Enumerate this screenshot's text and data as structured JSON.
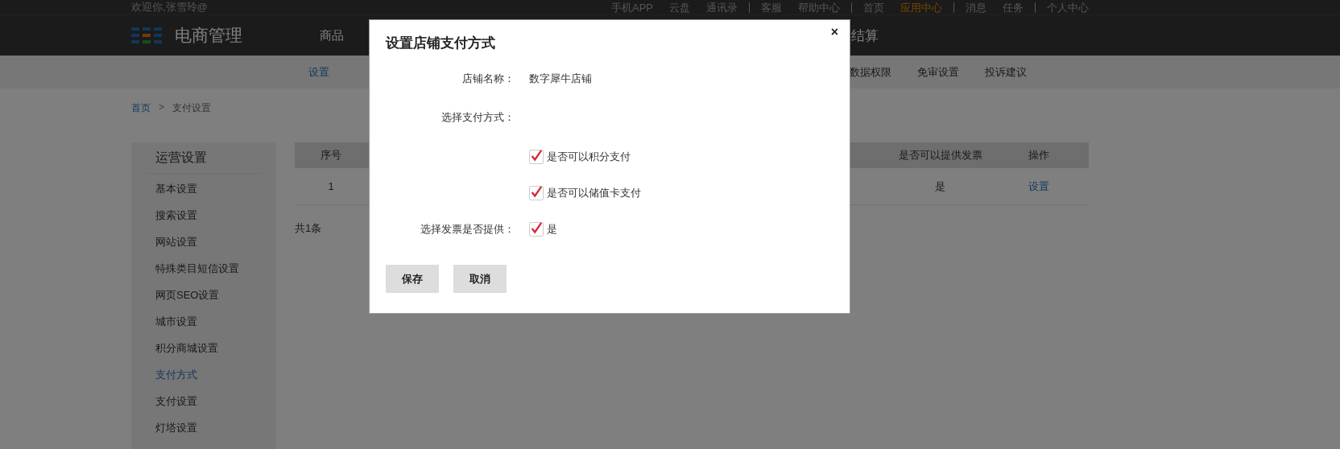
{
  "top_bar": {
    "welcome": "欢迎你,张雪玲@",
    "link_groups": [
      [
        {
          "label": "手机APP",
          "selected": false
        },
        {
          "label": "云盘",
          "selected": false
        },
        {
          "label": "通讯录",
          "selected": false
        }
      ],
      [
        {
          "label": "客服",
          "selected": false
        },
        {
          "label": "帮助中心",
          "selected": false
        }
      ],
      [
        {
          "label": "首页",
          "selected": false
        },
        {
          "label": "应用中心",
          "selected": true
        }
      ],
      [
        {
          "label": "消息",
          "selected": false
        },
        {
          "label": "任务",
          "selected": false
        }
      ],
      [
        {
          "label": "个人中心",
          "selected": false
        }
      ]
    ]
  },
  "header": {
    "logo_text": "电商管理",
    "nav_left": [
      "商品"
    ],
    "nav_right": [
      "结算"
    ]
  },
  "sub_nav": {
    "left": [
      {
        "label": "设置",
        "selected": true
      }
    ],
    "right": [
      {
        "label": "数据权限",
        "selected": false
      },
      {
        "label": "免审设置",
        "selected": false
      },
      {
        "label": "投诉建议",
        "selected": false
      }
    ]
  },
  "breadcrumb": [
    {
      "label": "首页",
      "kind": "link"
    },
    {
      "label": ">",
      "kind": "separator"
    },
    {
      "label": "支付设置",
      "kind": "text"
    }
  ],
  "sidebar": {
    "title": "运营设置",
    "items": [
      {
        "label": "基本设置",
        "selected": false
      },
      {
        "label": "搜索设置",
        "selected": false
      },
      {
        "label": "网站设置",
        "selected": false
      },
      {
        "label": "特殊类目短信设置",
        "selected": false
      },
      {
        "label": "网页SEO设置",
        "selected": false
      },
      {
        "label": "城市设置",
        "selected": false
      },
      {
        "label": "积分商城设置",
        "selected": false
      },
      {
        "label": "支付方式",
        "selected": true
      },
      {
        "label": "支付设置",
        "selected": false
      },
      {
        "label": "灯塔设置",
        "selected": false
      }
    ]
  },
  "table": {
    "columns": [
      "序号",
      "是否可以提供发票",
      "操作"
    ],
    "rows": [
      {
        "cells": [
          "1",
          "是"
        ],
        "action": "设置"
      }
    ],
    "footer": "共1条"
  },
  "dialog": {
    "title": "设置店铺支付方式",
    "close": "×",
    "rows": [
      {
        "kind": "text",
        "label": "店铺名称：",
        "value": "数字犀牛店铺"
      },
      {
        "kind": "heading",
        "label": "选择支付方式："
      },
      {
        "kind": "checkbox",
        "option": "是否可以积分支付",
        "checked": true
      },
      {
        "kind": "checkbox",
        "option": "是否可以储值卡支付",
        "checked": true
      },
      {
        "kind": "checkbox",
        "label": "选择发票是否提供：",
        "option": "是",
        "checked": true
      }
    ],
    "buttons": [
      "保存",
      "取消"
    ]
  }
}
